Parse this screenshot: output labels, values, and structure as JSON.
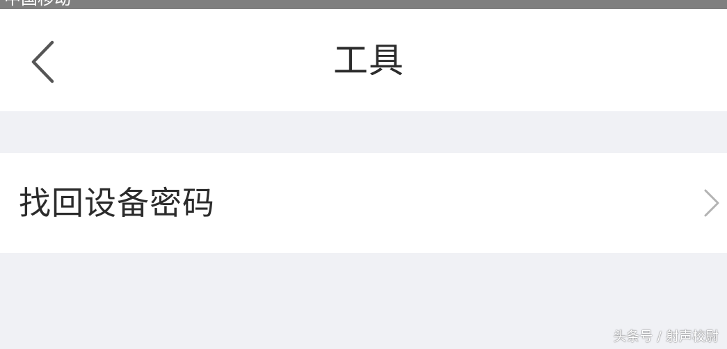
{
  "status_bar": {
    "carrier": "中国移动"
  },
  "nav_bar": {
    "back_icon": "chevron-left-icon",
    "title": "工具"
  },
  "list": {
    "items": [
      {
        "label": "找回设备密码",
        "trailing_icon": "chevron-right-icon"
      }
    ]
  },
  "watermark": {
    "text": "头条号 / 射声校尉"
  },
  "colors": {
    "page_background": "#f0f1f5",
    "surface": "#ffffff",
    "status_bar": "#7f7f7f",
    "text_primary": "#2b2b2b",
    "back_icon": "#555555",
    "chevron": "#b3b3b3"
  }
}
